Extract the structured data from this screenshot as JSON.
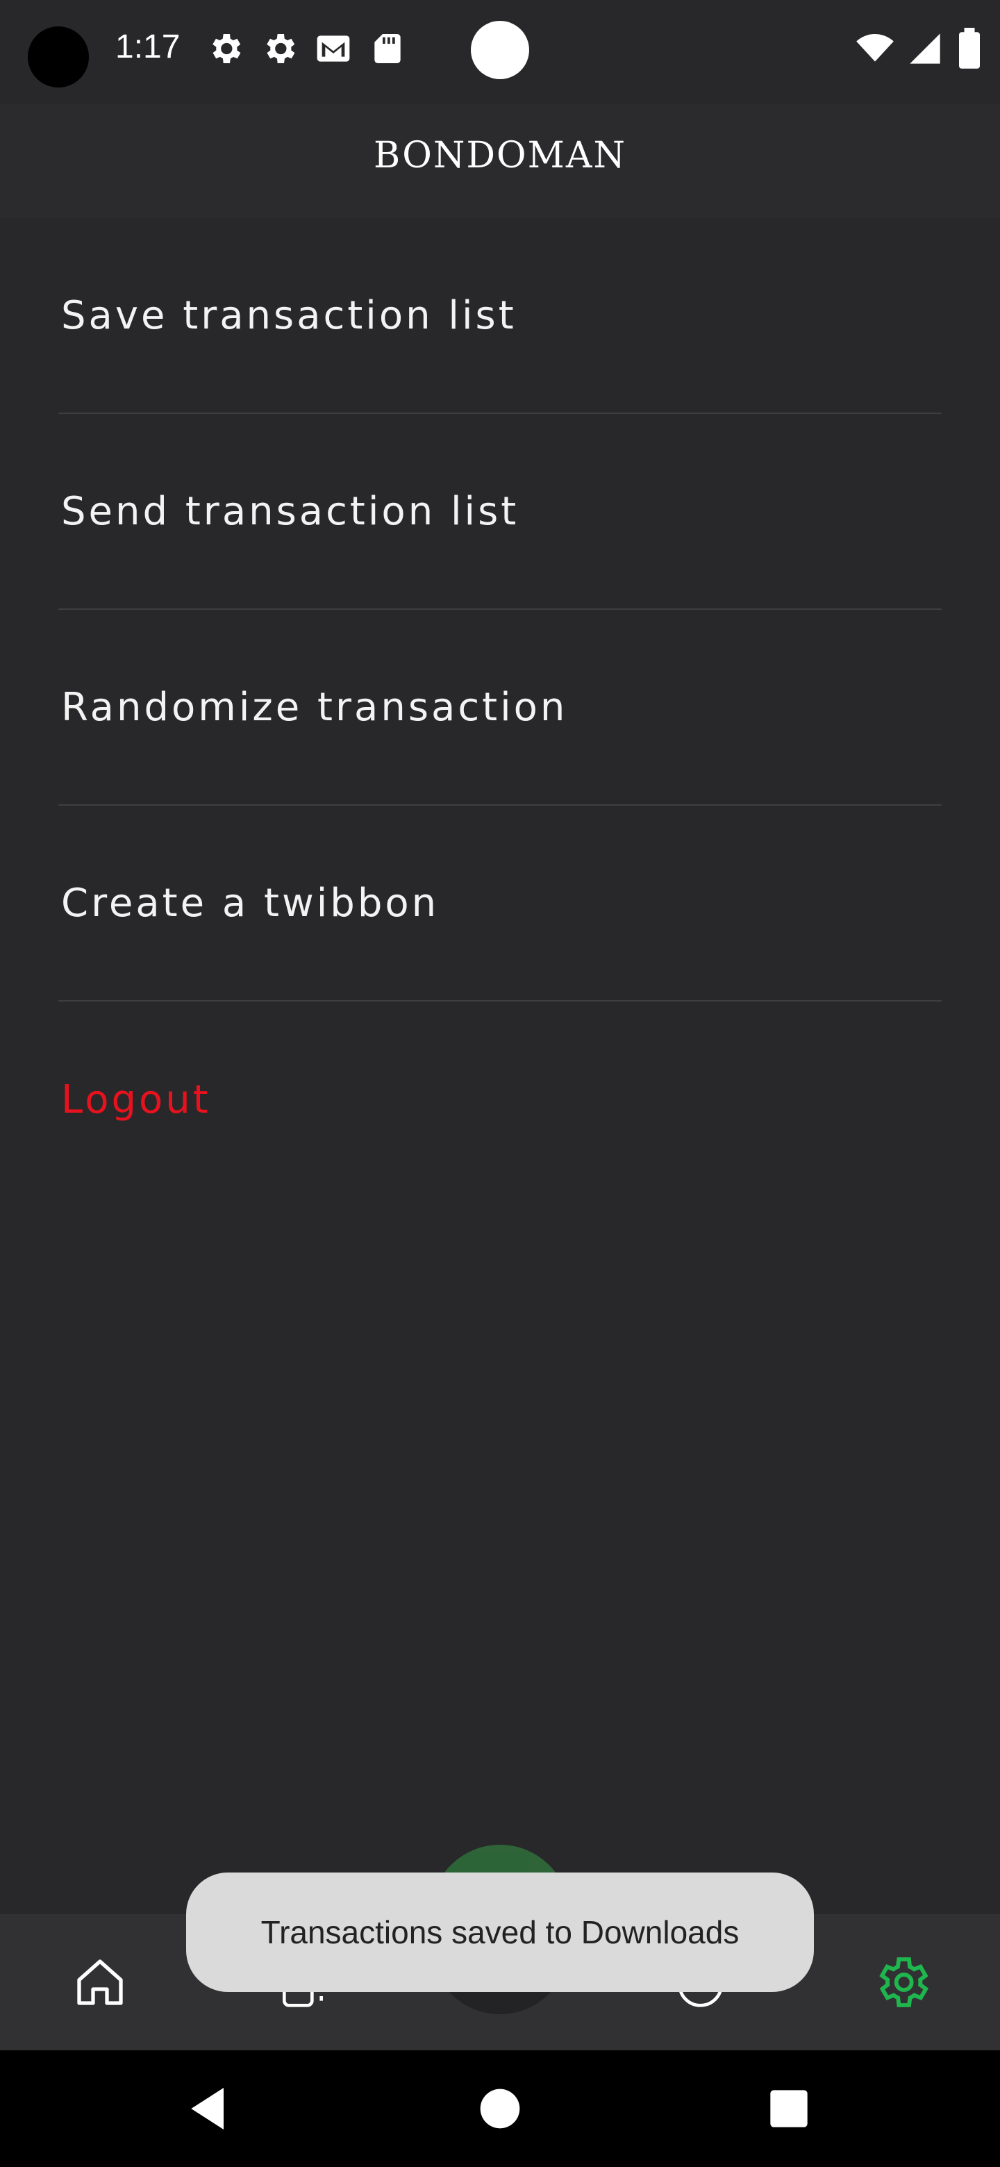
{
  "status_bar": {
    "time": "1:17",
    "left_icons": [
      "settings-icon",
      "settings-icon",
      "gmail-icon",
      "sd-card-icon"
    ],
    "right_icons": [
      "wifi-icon",
      "signal-icon",
      "battery-icon"
    ]
  },
  "header": {
    "title": "BONDOMAN"
  },
  "menu": {
    "items": [
      {
        "label": "Save transaction list"
      },
      {
        "label": "Send transaction list"
      },
      {
        "label": "Randomize transaction"
      },
      {
        "label": "Create a twibbon"
      },
      {
        "label": "Logout"
      }
    ]
  },
  "bottom_nav": {
    "items": [
      "home-icon",
      "transactions-icon",
      "scan-icon",
      "statistics-icon",
      "settings-icon"
    ],
    "active": "settings-icon",
    "active_color": "#1fb64e"
  },
  "toast": {
    "message": "Transactions saved to Downloads"
  },
  "system_nav": [
    "back-icon",
    "home-circle-icon",
    "recents-icon"
  ]
}
